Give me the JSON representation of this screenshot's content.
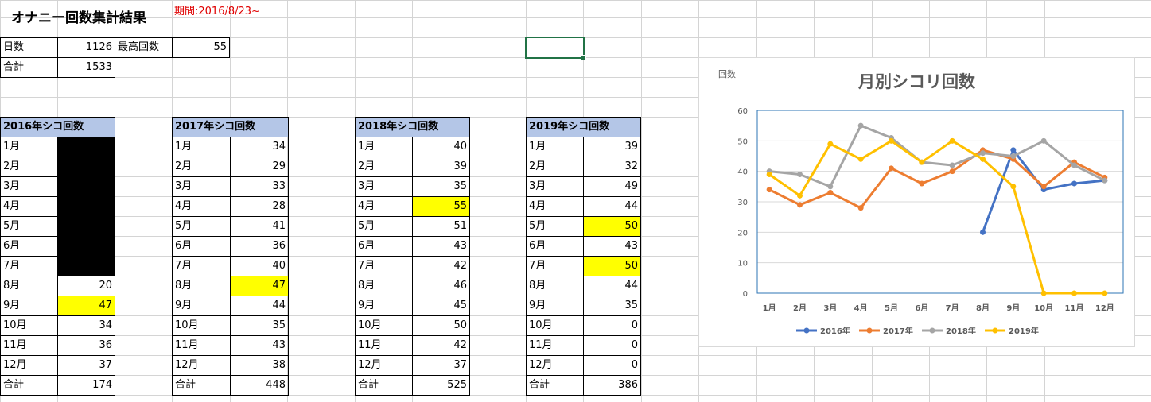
{
  "page": {
    "title": "オナニー回数集計結果",
    "period": "期間:2016/8/23~"
  },
  "summary": {
    "days_label": "日数",
    "days_value": "1126",
    "max_label": "最高回数",
    "max_value": "55",
    "total_label": "合計",
    "total_value": "1533"
  },
  "tables": [
    {
      "header": "2016年シコ回数",
      "rows": [
        {
          "month": "1月",
          "value": "",
          "style": "black"
        },
        {
          "month": "2月",
          "value": "",
          "style": "black"
        },
        {
          "month": "3月",
          "value": "",
          "style": "black"
        },
        {
          "month": "4月",
          "value": "",
          "style": "black"
        },
        {
          "month": "5月",
          "value": "",
          "style": "black"
        },
        {
          "month": "6月",
          "value": "",
          "style": "black"
        },
        {
          "month": "7月",
          "value": "",
          "style": "black"
        },
        {
          "month": "8月",
          "value": "20",
          "style": ""
        },
        {
          "month": "9月",
          "value": "47",
          "style": "yellow"
        },
        {
          "month": "10月",
          "value": "34",
          "style": ""
        },
        {
          "month": "11月",
          "value": "36",
          "style": ""
        },
        {
          "month": "12月",
          "value": "37",
          "style": ""
        }
      ],
      "total_label": "合計",
      "total_value": "174"
    },
    {
      "header": "2017年シコ回数",
      "rows": [
        {
          "month": "1月",
          "value": "34",
          "style": ""
        },
        {
          "month": "2月",
          "value": "29",
          "style": ""
        },
        {
          "month": "3月",
          "value": "33",
          "style": ""
        },
        {
          "month": "4月",
          "value": "28",
          "style": ""
        },
        {
          "month": "5月",
          "value": "41",
          "style": ""
        },
        {
          "month": "6月",
          "value": "36",
          "style": ""
        },
        {
          "month": "7月",
          "value": "40",
          "style": ""
        },
        {
          "month": "8月",
          "value": "47",
          "style": "yellow"
        },
        {
          "month": "9月",
          "value": "44",
          "style": ""
        },
        {
          "month": "10月",
          "value": "35",
          "style": ""
        },
        {
          "month": "11月",
          "value": "43",
          "style": ""
        },
        {
          "month": "12月",
          "value": "38",
          "style": ""
        }
      ],
      "total_label": "合計",
      "total_value": "448"
    },
    {
      "header": "2018年シコ回数",
      "rows": [
        {
          "month": "1月",
          "value": "40",
          "style": ""
        },
        {
          "month": "2月",
          "value": "39",
          "style": ""
        },
        {
          "month": "3月",
          "value": "35",
          "style": ""
        },
        {
          "month": "4月",
          "value": "55",
          "style": "yellow"
        },
        {
          "month": "5月",
          "value": "51",
          "style": ""
        },
        {
          "month": "6月",
          "value": "43",
          "style": ""
        },
        {
          "month": "7月",
          "value": "42",
          "style": ""
        },
        {
          "month": "8月",
          "value": "46",
          "style": ""
        },
        {
          "month": "9月",
          "value": "45",
          "style": ""
        },
        {
          "month": "10月",
          "value": "50",
          "style": ""
        },
        {
          "month": "11月",
          "value": "42",
          "style": ""
        },
        {
          "month": "12月",
          "value": "37",
          "style": ""
        }
      ],
      "total_label": "合計",
      "total_value": "525"
    },
    {
      "header": "2019年シコ回数",
      "rows": [
        {
          "month": "1月",
          "value": "39",
          "style": ""
        },
        {
          "month": "2月",
          "value": "32",
          "style": ""
        },
        {
          "month": "3月",
          "value": "49",
          "style": ""
        },
        {
          "month": "4月",
          "value": "44",
          "style": ""
        },
        {
          "month": "5月",
          "value": "50",
          "style": "yellow"
        },
        {
          "month": "6月",
          "value": "43",
          "style": ""
        },
        {
          "month": "7月",
          "value": "50",
          "style": "yellow"
        },
        {
          "month": "8月",
          "value": "44",
          "style": ""
        },
        {
          "month": "9月",
          "value": "35",
          "style": ""
        },
        {
          "month": "10月",
          "value": "0",
          "style": ""
        },
        {
          "month": "11月",
          "value": "0",
          "style": ""
        },
        {
          "month": "12月",
          "value": "0",
          "style": ""
        }
      ],
      "total_label": "合計",
      "total_value": "386"
    }
  ],
  "colors": {
    "header_fill": "#b4c6e7",
    "highlight": "#ffff00",
    "selection": "#217346"
  },
  "chart_data": {
    "type": "line",
    "title": "月別シコリ回数",
    "ylabel": "回数",
    "xlabel": "",
    "categories": [
      "1月",
      "2月",
      "3月",
      "4月",
      "5月",
      "6月",
      "7月",
      "8月",
      "9月",
      "10月",
      "11月",
      "12月"
    ],
    "ylim": [
      0,
      60
    ],
    "yticks": [
      0,
      10,
      20,
      30,
      40,
      50,
      60
    ],
    "grid": true,
    "legend": "bottom",
    "series": [
      {
        "name": "2016年",
        "color": "#4472c4",
        "values": [
          null,
          null,
          null,
          null,
          null,
          null,
          null,
          20,
          47,
          34,
          36,
          37
        ]
      },
      {
        "name": "2017年",
        "color": "#ed7d31",
        "values": [
          34,
          29,
          33,
          28,
          41,
          36,
          40,
          47,
          44,
          35,
          43,
          38
        ]
      },
      {
        "name": "2018年",
        "color": "#a5a5a5",
        "values": [
          40,
          39,
          35,
          55,
          51,
          43,
          42,
          46,
          45,
          50,
          42,
          37
        ]
      },
      {
        "name": "2019年",
        "color": "#ffc000",
        "values": [
          39,
          32,
          49,
          44,
          50,
          43,
          50,
          44,
          35,
          0,
          0,
          0
        ]
      }
    ]
  }
}
